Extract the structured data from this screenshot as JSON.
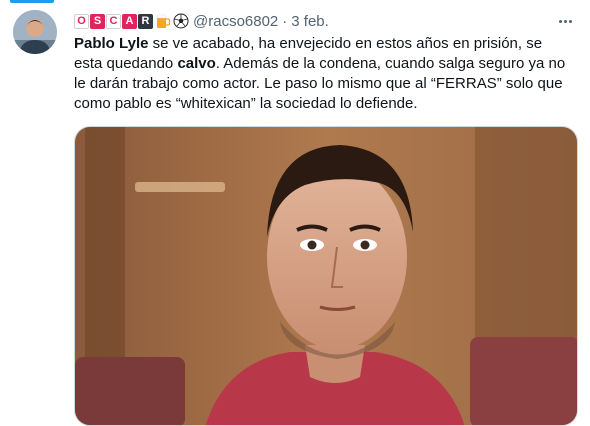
{
  "tweet": {
    "display_name_tiles": [
      "O",
      "S",
      "C",
      "A",
      "R"
    ],
    "display_name_emojis": [
      "beer-mug-icon",
      "soccer-ball-icon"
    ],
    "handle": "@racso6802",
    "separator": "·",
    "date": "3 feb.",
    "text_segments": [
      {
        "t": "Pablo Lyle",
        "bold": true
      },
      {
        "t": " se ve acabado, ha envejecido en estos años en prisión, se esta quedando ",
        "bold": false
      },
      {
        "t": "calvo",
        "bold": true
      },
      {
        "t": ". Además de la condena, cuando salga seguro ya no le darán trabajo como actor. Le paso lo mismo que al “FERRAS” solo que como pablo es “whitexican” la sociedad lo defiende.",
        "bold": false
      }
    ],
    "media": {
      "kind": "photo"
    }
  },
  "colors": {
    "accent": "#1d9bf0",
    "muted_text": "#536471",
    "tile_red": "#e0245e",
    "tile_dark": "#2f3640"
  },
  "icons": [
    "more-options-icon"
  ]
}
